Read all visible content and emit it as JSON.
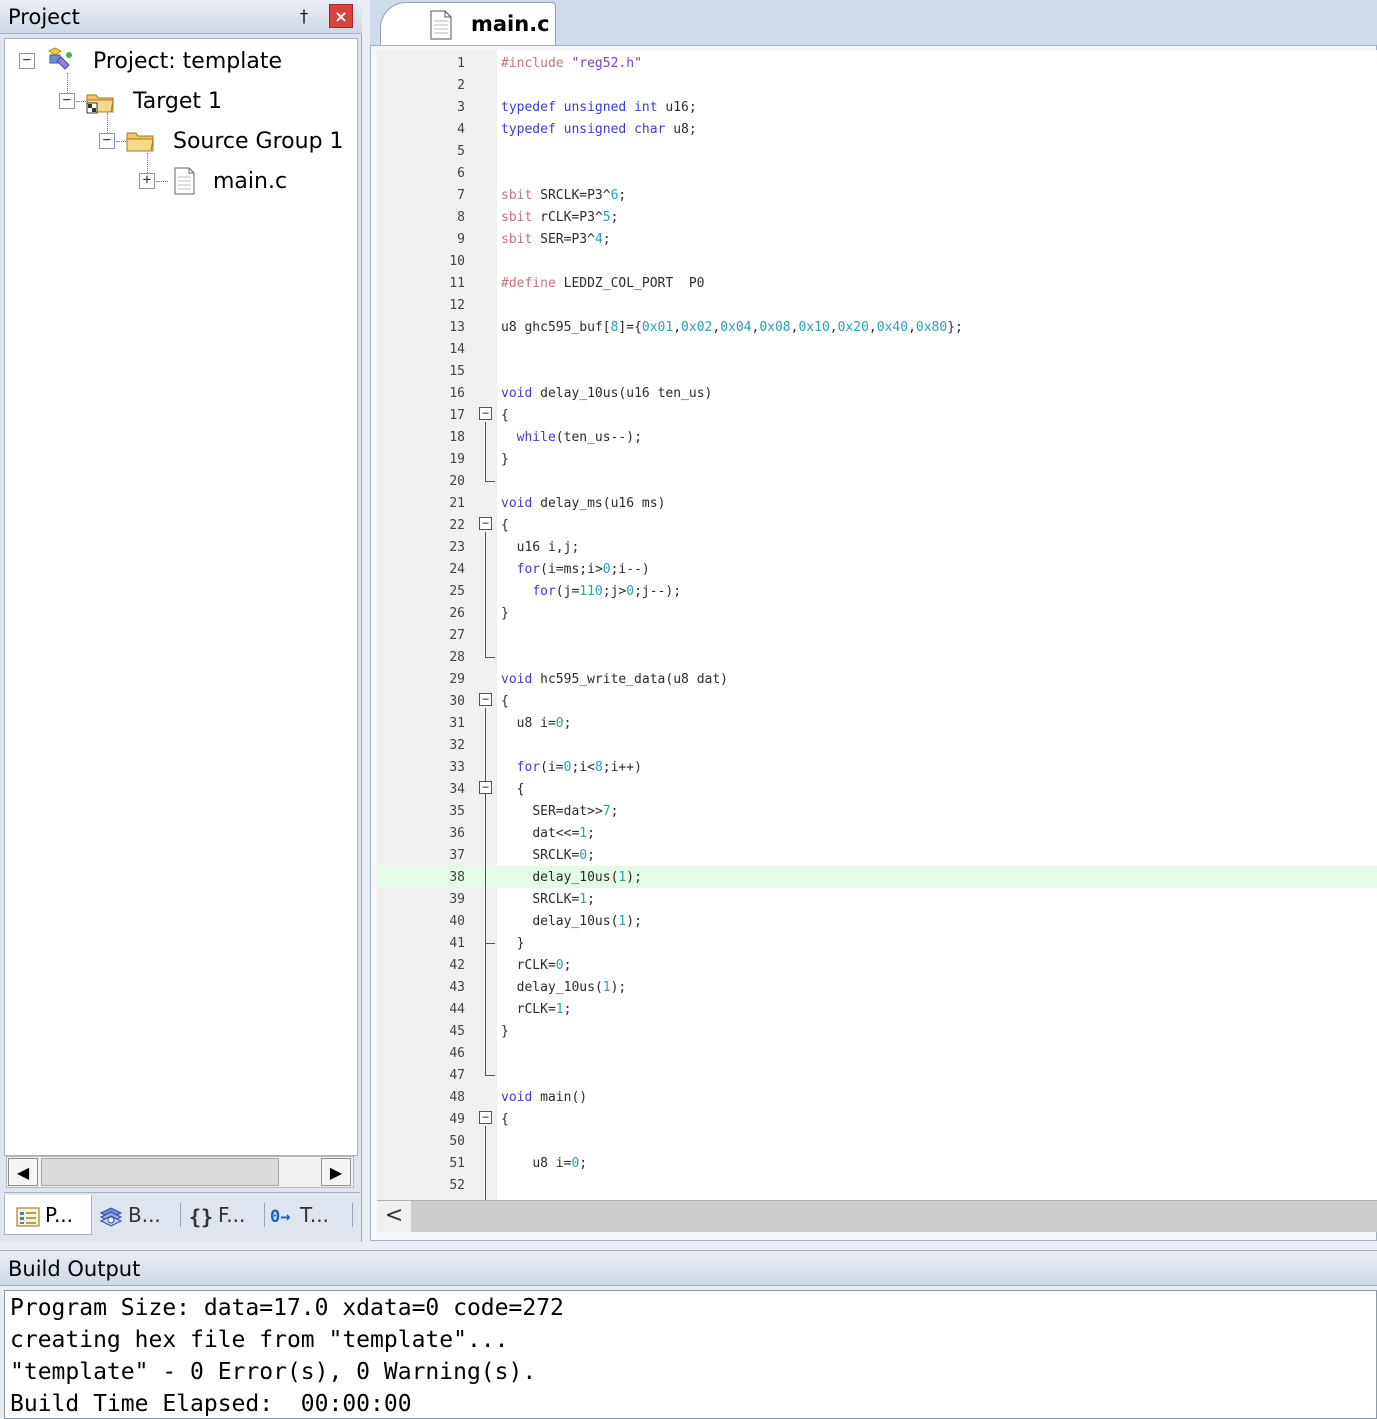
{
  "project_panel": {
    "title": "Project",
    "pin_glyph": "†",
    "close_glyph": "×",
    "tree": {
      "project": "Project: template",
      "target": "Target 1",
      "group": "Source Group 1",
      "file": "main.c"
    },
    "scroll_left": "◀",
    "scroll_right": "▶",
    "tabs": [
      {
        "label": "P...",
        "icon": "project-icon"
      },
      {
        "label": "B...",
        "icon": "books-icon"
      },
      {
        "label": "F...",
        "icon": "functions-icon"
      },
      {
        "label": "T...",
        "icon": "templates-icon"
      }
    ],
    "tab_glyphs": {
      "functions": "{}",
      "templates": "0→"
    }
  },
  "editor": {
    "tab_label": "main.c",
    "highlighted_line": 38,
    "scroll_left": "<",
    "lines": [
      {
        "n": "1",
        "t": "#include \"reg52.h\""
      },
      {
        "n": "2",
        "t": ""
      },
      {
        "n": "3",
        "t": "typedef unsigned int u16;"
      },
      {
        "n": "4",
        "t": "typedef unsigned char u8;"
      },
      {
        "n": "5",
        "t": ""
      },
      {
        "n": "6",
        "t": ""
      },
      {
        "n": "7",
        "t": "sbit SRCLK=P3^6;"
      },
      {
        "n": "8",
        "t": "sbit rCLK=P3^5;"
      },
      {
        "n": "9",
        "t": "sbit SER=P3^4;"
      },
      {
        "n": "10",
        "t": ""
      },
      {
        "n": "11",
        "t": "#define LEDDZ_COL_PORT  P0"
      },
      {
        "n": "12",
        "t": ""
      },
      {
        "n": "13",
        "t": "u8 ghc595_buf[8]={0x01,0x02,0x04,0x08,0x10,0x20,0x40,0x80};"
      },
      {
        "n": "14",
        "t": ""
      },
      {
        "n": "15",
        "t": ""
      },
      {
        "n": "16",
        "t": "void delay_10us(u16 ten_us)"
      },
      {
        "n": "17",
        "t": "{"
      },
      {
        "n": "18",
        "t": "  while(ten_us--);"
      },
      {
        "n": "19",
        "t": "}"
      },
      {
        "n": "20",
        "t": ""
      },
      {
        "n": "21",
        "t": "void delay_ms(u16 ms)"
      },
      {
        "n": "22",
        "t": "{"
      },
      {
        "n": "23",
        "t": "  u16 i,j;"
      },
      {
        "n": "24",
        "t": "  for(i=ms;i>0;i--)"
      },
      {
        "n": "25",
        "t": "    for(j=110;j>0;j--);"
      },
      {
        "n": "26",
        "t": "}"
      },
      {
        "n": "27",
        "t": ""
      },
      {
        "n": "28",
        "t": ""
      },
      {
        "n": "29",
        "t": "void hc595_write_data(u8 dat)"
      },
      {
        "n": "30",
        "t": "{"
      },
      {
        "n": "31",
        "t": "  u8 i=0;"
      },
      {
        "n": "32",
        "t": ""
      },
      {
        "n": "33",
        "t": "  for(i=0;i<8;i++)"
      },
      {
        "n": "34",
        "t": "  {"
      },
      {
        "n": "35",
        "t": "    SER=dat>>7;"
      },
      {
        "n": "36",
        "t": "    dat<<=1;"
      },
      {
        "n": "37",
        "t": "    SRCLK=0;"
      },
      {
        "n": "38",
        "t": "    delay_10us(1);"
      },
      {
        "n": "39",
        "t": "    SRCLK=1;"
      },
      {
        "n": "40",
        "t": "    delay_10us(1);"
      },
      {
        "n": "41",
        "t": "  }"
      },
      {
        "n": "42",
        "t": "  rCLK=0;"
      },
      {
        "n": "43",
        "t": "  delay_10us(1);"
      },
      {
        "n": "44",
        "t": "  rCLK=1;"
      },
      {
        "n": "45",
        "t": "}"
      },
      {
        "n": "46",
        "t": ""
      },
      {
        "n": "47",
        "t": ""
      },
      {
        "n": "48",
        "t": "void main()"
      },
      {
        "n": "49",
        "t": "{"
      },
      {
        "n": "50",
        "t": ""
      },
      {
        "n": "51",
        "t": "    u8 i=0;"
      },
      {
        "n": "52",
        "t": ""
      }
    ],
    "fold_blocks": [
      {
        "start": 17,
        "end": 20
      },
      {
        "start": 22,
        "end": 28
      },
      {
        "start": 30,
        "end": 47,
        "inner": {
          "start": 34,
          "end": 41
        }
      },
      {
        "start": 49,
        "end": 53
      }
    ]
  },
  "build_output": {
    "title": "Build Output",
    "lines": [
      "Program Size: data=17.0 xdata=0 code=272",
      "creating hex file from \"template\"...",
      "\"template\" - 0 Error(s), 0 Warning(s).",
      "Build Time Elapsed:  00:00:00"
    ]
  },
  "colors": {
    "keyword": "#3b3bd6",
    "preprocessor": "#c4747a",
    "number": "#2aa0b2",
    "string": "#7a3fc2",
    "plain": "#2b2b2b",
    "highlight": "#e5fbe5"
  }
}
